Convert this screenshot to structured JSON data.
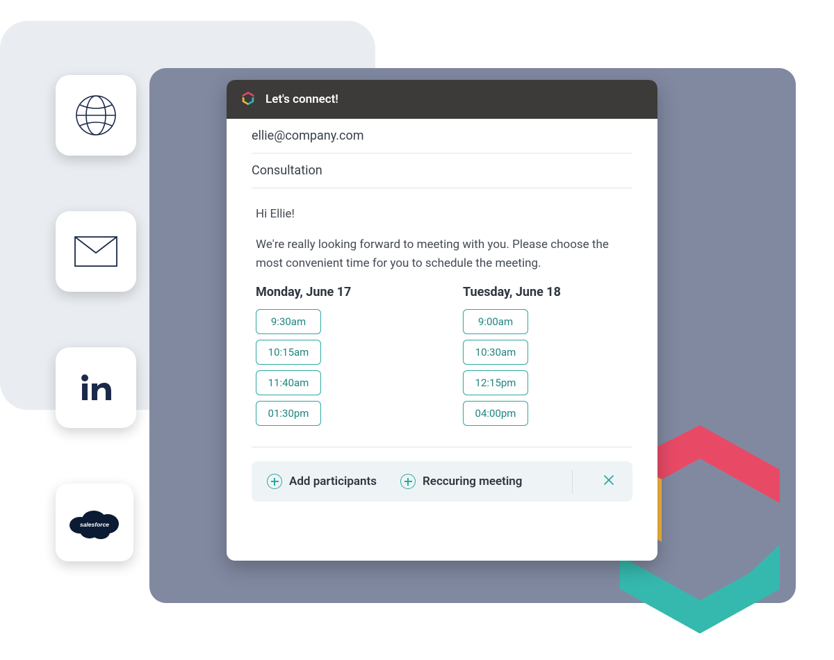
{
  "header": {
    "title": "Let's connect!"
  },
  "compose": {
    "to": "ellie@company.com",
    "subject": "Consultation",
    "body": {
      "greeting": "Hi Ellie!",
      "paragraph": "We're really looking forward to meeting with you. Please choose the most convenient time for you to schedule the meeting."
    }
  },
  "schedule": {
    "days": [
      {
        "label": "Monday, June 17",
        "slots": [
          "9:30am",
          "10:15am",
          "11:40am",
          "01:30pm"
        ]
      },
      {
        "label": "Tuesday, June 18",
        "slots": [
          "9:00am",
          "10:30am",
          "12:15pm",
          "04:00pm"
        ]
      }
    ]
  },
  "actions": {
    "add_participants": "Add participants",
    "recurring_meeting": "Reccuring meeting"
  },
  "integrations": [
    "website",
    "email",
    "linkedin",
    "salesforce"
  ],
  "colors": {
    "teal": "#2DA8A1",
    "header_bg": "#3C3B3A",
    "panel_gray": "#8189A1",
    "brand_red": "#E84A66",
    "brand_yellow": "#F2B63D",
    "brand_teal": "#35B9AE"
  }
}
